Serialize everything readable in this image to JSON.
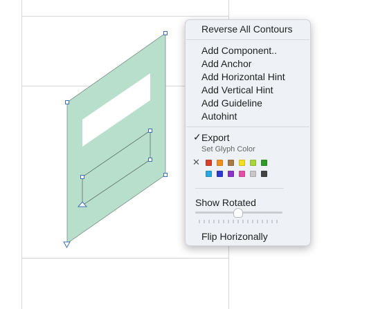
{
  "menu": {
    "reverse_all_contours": "Reverse All Contours",
    "add_component": "Add Component..",
    "add_anchor": "Add Anchor",
    "add_horizontal_hint": "Add Horizontal Hint",
    "add_vertical_hint": "Add Vertical Hint",
    "add_guideline": "Add Guideline",
    "autohint": "Autohint",
    "export_checkmark": "✓",
    "export": "Export",
    "set_glyph_color": "Set Glyph Color",
    "clear_color_glyph": "✕",
    "show_rotated": "Show Rotated",
    "flip_horizonally": "Flip Horizonally"
  },
  "glyph_colors": {
    "row1": [
      "#d9402b",
      "#f0901e",
      "#a87a45",
      "#f2df1f",
      "#a6d63a",
      "#2e9a2a"
    ],
    "row2": [
      "#2aa6e0",
      "#2c3bd0",
      "#8a35c7",
      "#e44fa6",
      "#c7c7c7",
      "#444444"
    ]
  },
  "show_rotated_slider": {
    "value": 0.5
  },
  "colors": {
    "glyph_fill": "#b8dfcb",
    "node_outline": "#3b6fb6",
    "guide_line": "#d6d6d6"
  },
  "icons": {
    "cursor": "arrow-cursor-icon"
  }
}
